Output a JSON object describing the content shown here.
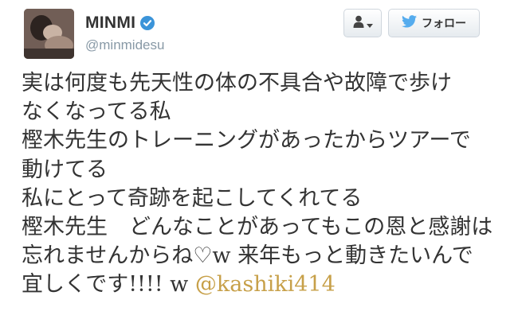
{
  "profile": {
    "display_name": "MINMI",
    "handle": "@minmidesu",
    "verified": true
  },
  "actions": {
    "follow_label": "フォロー"
  },
  "tweet": {
    "lines": [
      "実は何度も先天性の体の不具合や故障で歩け",
      "なくなってる私",
      "樫木先生のトレーニングがあったからツアーで",
      "動けてる",
      "私にとって奇跡を起こしてくれてる",
      "樫木先生　どんなことがあってもこの恩と感謝は",
      "忘れませんからね♡w 来年もっと動きたいんで"
    ],
    "last_line_text": "宜しくです!!!! w ",
    "mention": "@kashiki414"
  },
  "colors": {
    "verified_blue": "#3b94d9",
    "twitter_blue": "#55acee",
    "mention_gold": "#c7a049",
    "handle_gray": "#8899a6"
  },
  "icons": [
    "verified-badge-icon",
    "user-icon",
    "caret-down-icon",
    "twitter-bird-icon"
  ]
}
